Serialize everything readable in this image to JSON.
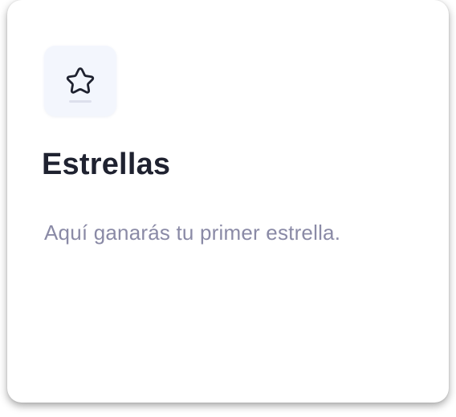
{
  "card": {
    "icon": "star-icon",
    "title": "Estrellas",
    "description": "Aquí ganarás tu primer estrella."
  },
  "colors": {
    "icon_bg": "#f3f6fd",
    "icon_stroke": "#1f2230",
    "title": "#1f2230",
    "description": "#8a8aa6"
  }
}
